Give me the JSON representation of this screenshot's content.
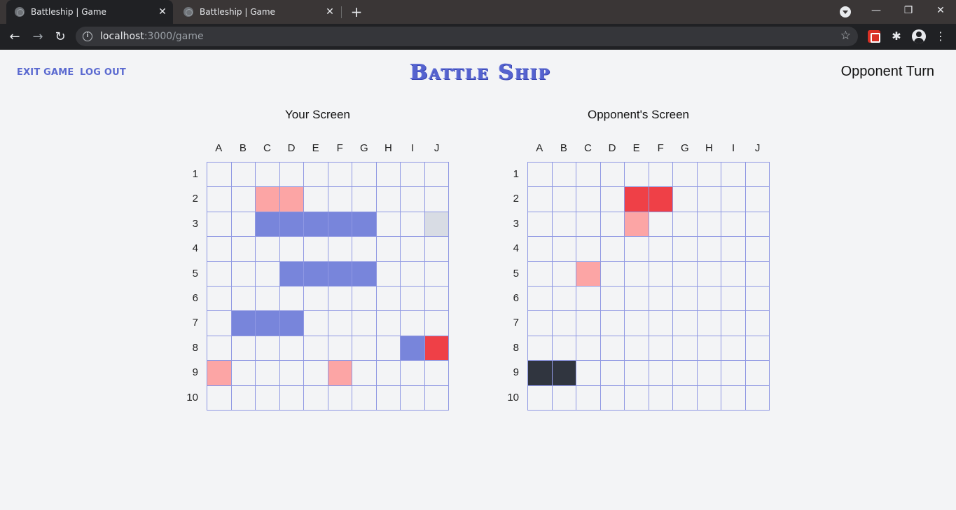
{
  "browser": {
    "tabs": [
      {
        "title": "Battleship | Game",
        "active": true
      },
      {
        "title": "Battleship | Game",
        "active": false
      }
    ],
    "url_host": "localhost",
    "url_path": ":3000/game"
  },
  "header": {
    "exit_label": "EXIT GAME",
    "logout_label": "LOG OUT",
    "logo_text": "Battle Ship",
    "turn_status": "Opponent Turn"
  },
  "colors": {
    "accent": "#5b6ad0",
    "ship": "#7885db",
    "miss": "#fca5a5",
    "hit": "#ef4047",
    "sunk": "#30353f",
    "pending": "#d8dce4"
  },
  "columns": [
    "A",
    "B",
    "C",
    "D",
    "E",
    "F",
    "G",
    "H",
    "I",
    "J"
  ],
  "rows": [
    "1",
    "2",
    "3",
    "4",
    "5",
    "6",
    "7",
    "8",
    "9",
    "10"
  ],
  "boards": [
    {
      "title": "Your Screen",
      "cells": {
        "C2": "miss",
        "D2": "miss",
        "C3": "ship",
        "D3": "ship",
        "E3": "ship",
        "F3": "ship",
        "G3": "ship",
        "J3": "pending",
        "D5": "ship",
        "E5": "ship",
        "F5": "ship",
        "G5": "ship",
        "B7": "ship",
        "C7": "ship",
        "D7": "ship",
        "I8": "ship",
        "J8": "hit",
        "A9": "miss",
        "F9": "miss"
      }
    },
    {
      "title": "Opponent's Screen",
      "cells": {
        "E2": "hit",
        "F2": "hit",
        "E3": "miss",
        "C5": "miss",
        "A9": "sunk",
        "B9": "sunk"
      }
    }
  ]
}
